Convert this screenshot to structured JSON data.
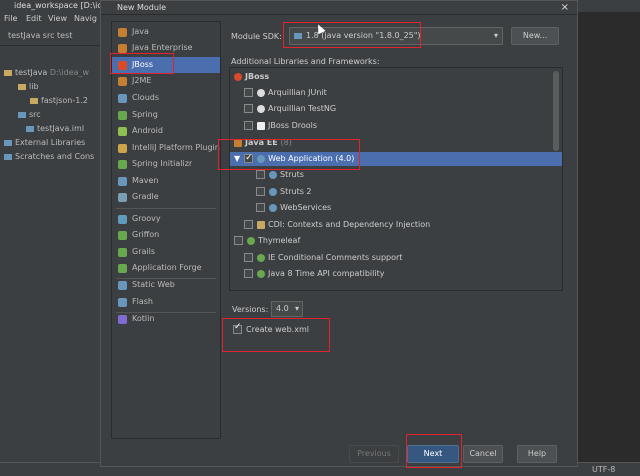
{
  "ide": {
    "title": "idea_workspace [D:\\id",
    "menu": [
      "File",
      "Edit",
      "View",
      "Navig"
    ],
    "breadcrumb": "testJava  src  test",
    "tree": [
      {
        "label": "testJava",
        "extra": "D:\\idea_w"
      },
      {
        "label": "lib"
      },
      {
        "label": "fastjson-1.2"
      },
      {
        "label": "src"
      },
      {
        "label": "testJava.iml"
      },
      {
        "label": "External Libraries"
      },
      {
        "label": "Scratches and Cons"
      }
    ],
    "status_right": "UTF-8"
  },
  "dialog": {
    "title": "New Module",
    "close": "×",
    "left_items": [
      {
        "label": "Java",
        "color": "#c47f33"
      },
      {
        "label": "Java Enterprise",
        "color": "#c47f33"
      },
      {
        "label": "JBoss",
        "color": "#d94a2a",
        "selected": true
      },
      {
        "label": "J2ME",
        "color": "#c47f33"
      },
      {
        "label": "Clouds",
        "color": "#6897bb"
      },
      {
        "label": "Spring",
        "color": "#6aa84f"
      },
      {
        "label": "Android",
        "color": "#8cc152"
      },
      {
        "label": "IntelliJ Platform Plugin",
        "color": "#cfa34c"
      },
      {
        "label": "Spring Initializr",
        "color": "#6aa84f"
      },
      {
        "label": "Maven",
        "color": "#6897bb"
      },
      {
        "label": "Gradle",
        "color": "#7a9fb5"
      },
      {
        "label": "Groovy",
        "color": "#5d9cbb"
      },
      {
        "label": "Griffon",
        "color": "#6aa84f"
      },
      {
        "label": "Grails",
        "color": "#6aa84f"
      },
      {
        "label": "Application Forge",
        "color": "#6aa84f"
      },
      {
        "label": "Static Web",
        "color": "#6897bb"
      },
      {
        "label": "Flash",
        "color": "#6897bb"
      },
      {
        "label": "Kotlin",
        "color": "#7f6bd1"
      }
    ],
    "sdk_label": "Module SDK:",
    "sdk_value": "1.8  (java version \"1.8.0_25\")",
    "new_button": "New...",
    "libs_label": "Additional Libraries and Frameworks:",
    "libs": {
      "jboss_group": "JBoss",
      "arquillian_junit": "Arquillian JUnit",
      "arquillian_testng": "Arquillian TestNG",
      "jboss_drools": "JBoss Drools",
      "javaee_group": "Java EE",
      "javaee_count": "(8)",
      "web_app": "Web Application (4.0)",
      "struts": "Struts",
      "struts2": "Struts 2",
      "webservices": "WebServices",
      "cdi": "CDI: Contexts and Dependency Injection",
      "thymeleaf": "Thymeleaf",
      "ie_comments": "IE Conditional Comments support",
      "java8_time": "Java 8 Time API compatibility"
    },
    "versions_label": "Versions:",
    "versions_value": "4.0",
    "create_web_xml": "Create web.xml",
    "buttons": {
      "previous": "Previous",
      "next": "Next",
      "cancel": "Cancel",
      "help": "Help"
    }
  },
  "colors": {
    "selection": "#4b6eaf",
    "annotation_red": "#e0232e",
    "primary_button": "#365880"
  }
}
